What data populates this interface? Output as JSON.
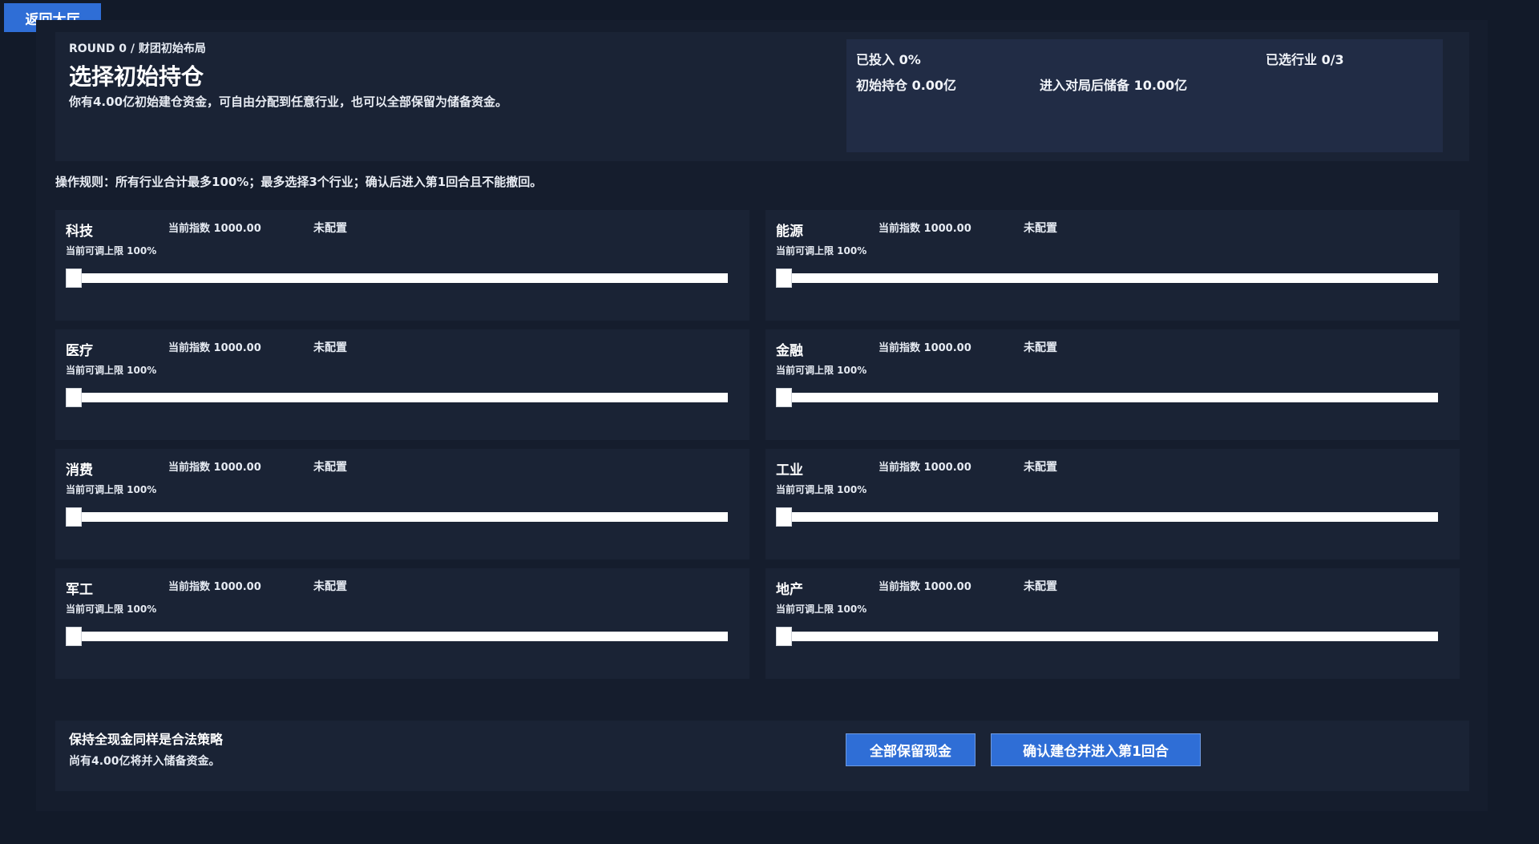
{
  "back_button": {
    "label": "返回大厅"
  },
  "header": {
    "round_label": "ROUND 0 / 财团初始布局",
    "title": "选择初始持仓",
    "description": "你有4.00亿初始建仓资金，可自由分配到任意行业，也可以全部保留为储备资金。",
    "stats": {
      "invested": "已投入 0%",
      "selected": "已选行业 0/3",
      "holding": "初始持仓 0.00亿",
      "reserve": "进入对局后储备 10.00亿"
    }
  },
  "rules": "操作规则：所有行业合计最多100%；最多选择3个行业；确认后进入第1回合且不能撤回。",
  "sectors": [
    {
      "name": "科技",
      "index": "当前指数 1000.00",
      "status": "未配置",
      "limit": "当前可调上限 100%",
      "allocation": 0
    },
    {
      "name": "能源",
      "index": "当前指数 1000.00",
      "status": "未配置",
      "limit": "当前可调上限 100%",
      "allocation": 0
    },
    {
      "name": "医疗",
      "index": "当前指数 1000.00",
      "status": "未配置",
      "limit": "当前可调上限 100%",
      "allocation": 0
    },
    {
      "name": "金融",
      "index": "当前指数 1000.00",
      "status": "未配置",
      "limit": "当前可调上限 100%",
      "allocation": 0
    },
    {
      "name": "消费",
      "index": "当前指数 1000.00",
      "status": "未配置",
      "limit": "当前可调上限 100%",
      "allocation": 0
    },
    {
      "name": "工业",
      "index": "当前指数 1000.00",
      "status": "未配置",
      "limit": "当前可调上限 100%",
      "allocation": 0
    },
    {
      "name": "军工",
      "index": "当前指数 1000.00",
      "status": "未配置",
      "limit": "当前可调上限 100%",
      "allocation": 0
    },
    {
      "name": "地产",
      "index": "当前指数 1000.00",
      "status": "未配置",
      "limit": "当前可调上限 100%",
      "allocation": 0
    }
  ],
  "footer": {
    "title": "保持全现金同样是合法策略",
    "subtitle": "尚有4.00亿将并入储备资金。",
    "keep_cash_label": "全部保留现金",
    "confirm_label": "确认建仓并进入第1回合"
  },
  "colors": {
    "background": "#121a29",
    "panel": "#1a2335",
    "stats_panel": "#212c45",
    "accent": "#2f6ed6"
  }
}
